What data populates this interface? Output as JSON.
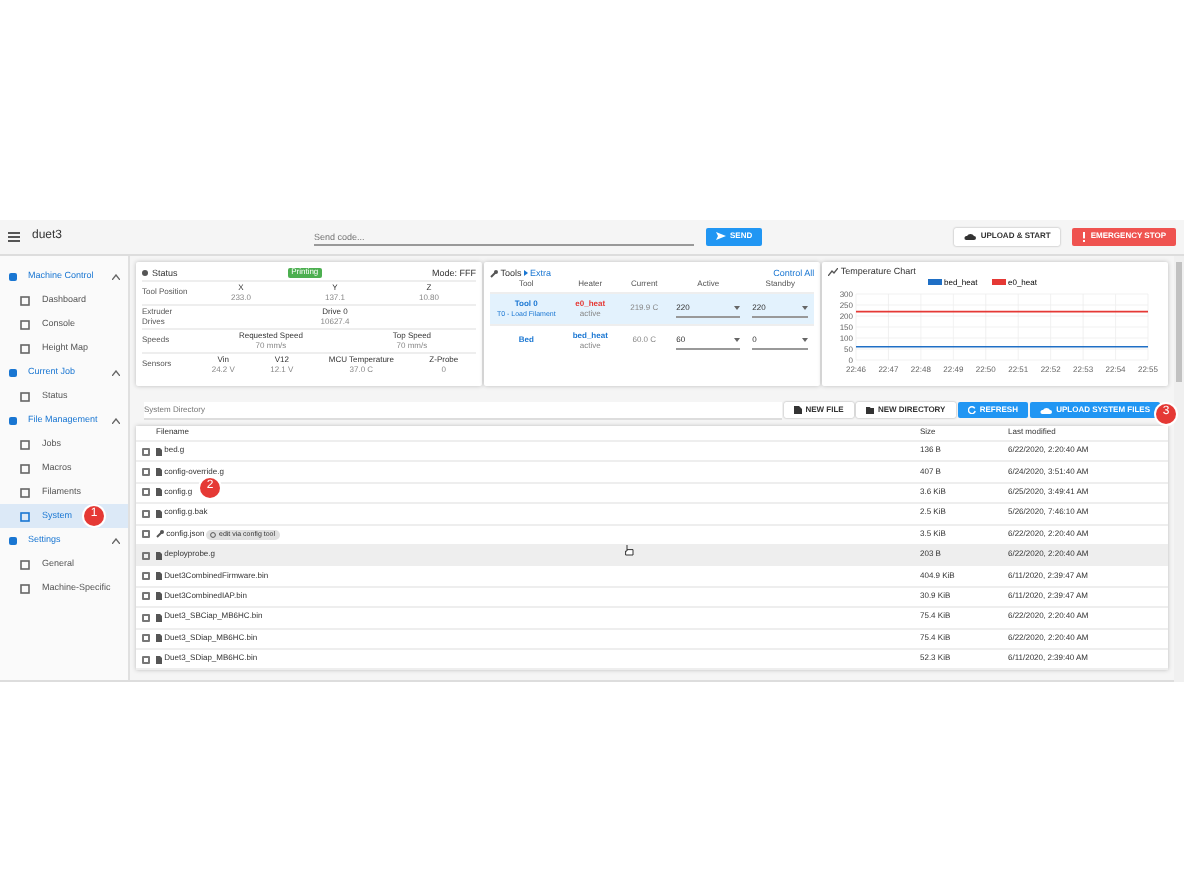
{
  "top_bar": {
    "title": "duet3",
    "code_placeholder": "Send code...",
    "send_button": "SEND",
    "upload_button": "UPLOAD & START",
    "stop_button": "EMERGENCY STOP"
  },
  "sidebar": [
    {
      "label": "Machine Control",
      "expanded": true,
      "children": [
        {
          "label": "Dashboard",
          "selected": false
        },
        {
          "label": "Console",
          "selected": false
        },
        {
          "label": "Height Map",
          "selected": false
        }
      ]
    },
    {
      "label": "Current Job",
      "expanded": true,
      "children": [
        {
          "label": "Status",
          "selected": false
        }
      ]
    },
    {
      "label": "File Management",
      "expanded": true,
      "children": [
        {
          "label": "Jobs",
          "selected": false
        },
        {
          "label": "Macros",
          "selected": false
        },
        {
          "label": "Filaments",
          "selected": false
        },
        {
          "label": "System",
          "selected": true
        }
      ]
    },
    {
      "label": "Settings",
      "expanded": true,
      "children": [
        {
          "label": "General",
          "selected": false
        },
        {
          "label": "Machine-Specific",
          "selected": false
        }
      ]
    }
  ],
  "status_panel": {
    "title": "Status",
    "badge": "Printing",
    "mode": "Mode: FFF",
    "rows": [
      {
        "label": "Tool Position",
        "readings": [
          {
            "name": "X",
            "value": "233.0"
          },
          {
            "name": "Y",
            "value": "137.1"
          },
          {
            "name": "Z",
            "value": "10.80"
          }
        ]
      },
      {
        "label": "Extruder Drives",
        "readings": [
          {
            "name": "Drive 0",
            "value": "10627.4"
          }
        ]
      },
      {
        "label": "Speeds",
        "readings": [
          {
            "name": "Requested Speed",
            "value": "70 mm/s"
          },
          {
            "name": "Top Speed",
            "value": "70 mm/s"
          }
        ]
      },
      {
        "label": "Sensors",
        "readings": [
          {
            "name": "Vin",
            "value": "24.2 V"
          },
          {
            "name": "V12",
            "value": "12.1 V"
          },
          {
            "name": "MCU Temperature",
            "value": "37.0 C"
          },
          {
            "name": "Z-Probe",
            "value": "0"
          }
        ]
      }
    ]
  },
  "tools_panel": {
    "title": "Tools",
    "extra": "Extra",
    "control_all": "Control All",
    "columns": [
      "Tool",
      "Heater",
      "Current",
      "Active",
      "Standby"
    ],
    "rows": [
      {
        "tool": "Tool 0",
        "tool_note": "T0 - Load Filament",
        "heater": "e0_heat",
        "heater_state": "active",
        "current": "219.9 C",
        "active": "220",
        "standby": "220",
        "selected": true
      },
      {
        "tool": "Bed",
        "heater": "bed_heat",
        "heater_state": "active",
        "current": "60.0 C",
        "active": "60",
        "standby": "0",
        "selected": false
      }
    ]
  },
  "temperature_chart": {
    "title": "Temperature Chart",
    "chart_data": {
      "type": "line",
      "x": [
        "22:46",
        "22:47",
        "22:48",
        "22:49",
        "22:50",
        "22:51",
        "22:52",
        "22:53",
        "22:54",
        "22:55"
      ],
      "ylim": [
        0,
        300
      ],
      "grid": true,
      "legend": true,
      "yticks": [
        0,
        50,
        100,
        150,
        200,
        250,
        300
      ],
      "series": [
        {
          "name": "bed_heat",
          "color": "#1f6fc5",
          "values": [
            60,
            60,
            60,
            60,
            60,
            60,
            60,
            60,
            60,
            60
          ]
        },
        {
          "name": "e0_heat",
          "color": "#e53935",
          "values": [
            220,
            220,
            220,
            220,
            220,
            220,
            220,
            220,
            220,
            220
          ]
        }
      ]
    }
  },
  "files": {
    "path_placeholder": "System Directory",
    "buttons": [
      "NEW FILE",
      "NEW DIRECTORY",
      "REFRESH",
      "UPLOAD SYSTEM FILES"
    ],
    "columns": [
      "Filename",
      "Size",
      "Last modified"
    ],
    "rows": [
      {
        "name": "bed.g",
        "size": "136 B",
        "modified": "6/22/2020, 2:20:40 AM",
        "checked": false,
        "hovered": false
      },
      {
        "name": "config-override.g",
        "size": "407 B",
        "modified": "6/24/2020, 3:51:40 AM",
        "checked": false,
        "hovered": false
      },
      {
        "name": "config.g",
        "size": "3.6 KiB",
        "modified": "6/25/2020, 3:49:41 AM",
        "checked": false,
        "hovered": false
      },
      {
        "name": "config.g.bak",
        "size": "2.5 KiB",
        "modified": "5/26/2020, 7:46:10 AM",
        "checked": false,
        "hovered": false
      },
      {
        "name": "config.json",
        "size": "3.5 KiB",
        "modified": "6/22/2020, 2:20:40 AM",
        "checked": false,
        "hovered": false,
        "chip": "edit via config tool"
      },
      {
        "name": "deployprobe.g",
        "size": "203 B",
        "modified": "6/22/2020, 2:20:40 AM",
        "checked": false,
        "hovered": true
      },
      {
        "name": "Duet3CombinedFirmware.bin",
        "size": "404.9 KiB",
        "modified": "6/11/2020, 2:39:47 AM",
        "checked": false,
        "hovered": false
      },
      {
        "name": "Duet3CombinedIAP.bin",
        "size": "30.9 KiB",
        "modified": "6/11/2020, 2:39:47 AM",
        "checked": false,
        "hovered": false
      },
      {
        "name": "Duet3_SBCiap_MB6HC.bin",
        "size": "75.4 KiB",
        "modified": "6/22/2020, 2:20:40 AM",
        "checked": false,
        "hovered": false
      },
      {
        "name": "Duet3_SDiap_MB6HC.bin",
        "size": "75.4 KiB",
        "modified": "6/22/2020, 2:20:40 AM",
        "checked": false,
        "hovered": false
      },
      {
        "name": "Duet3_SDiap_MB6HC.bin",
        "size": "52.3 KiB",
        "modified": "6/11/2020, 2:39:40 AM",
        "checked": false,
        "hovered": false
      }
    ]
  },
  "callouts": [
    "1",
    "2",
    "3"
  ]
}
